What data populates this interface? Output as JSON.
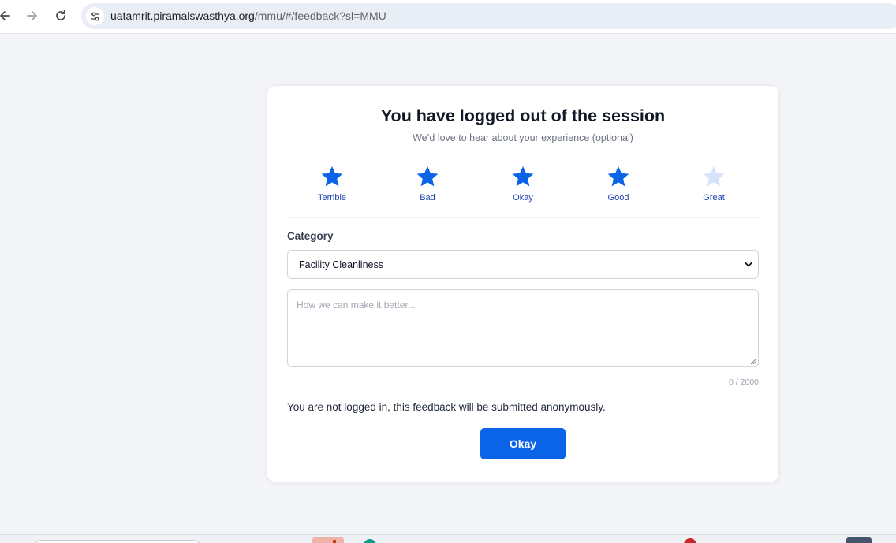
{
  "browser": {
    "url_host": "uatamrit.piramalswasthya.org",
    "url_path": "/mmu/#/feedback?sl=MMU",
    "icons": [
      "back-arrow-icon",
      "forward-arrow-icon",
      "reload-icon",
      "site-settings-icon"
    ]
  },
  "feedback": {
    "title": "You have logged out of the session",
    "subtitle": "We’d love to hear about your experience (optional)",
    "selected_rating": 4,
    "max_rating": 5,
    "ratings": [
      {
        "label": "Terrible"
      },
      {
        "label": "Bad"
      },
      {
        "label": "Okay"
      },
      {
        "label": "Good"
      },
      {
        "label": "Great"
      }
    ],
    "category_label": "Category",
    "category_value": "Facility Cleanliness",
    "comment_placeholder": "How we can make it better...",
    "char_counter": "0 / 2000",
    "anonymous_note": "You are not logged in, this feedback will be submitted anonymously.",
    "submit_label": "Okay"
  },
  "colors": {
    "star_active": "#0b63e8",
    "star_inactive": "#d6e4fb",
    "primary_button": "#0b63e8",
    "page_background": "#f4f5f9"
  }
}
